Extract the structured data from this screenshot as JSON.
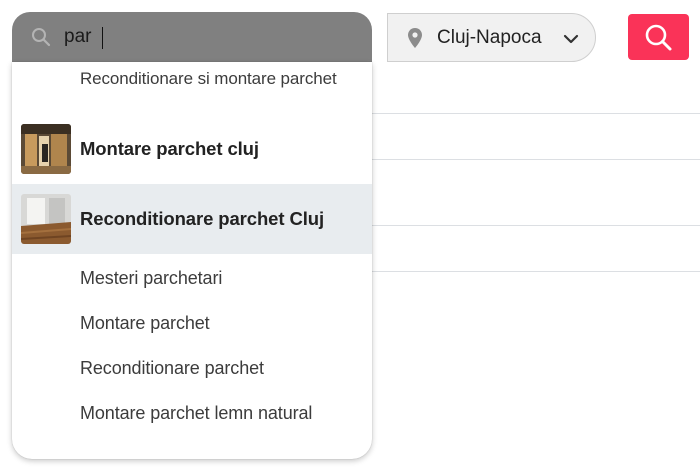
{
  "search": {
    "query": "par",
    "suggestions": [
      {
        "label": "Reconditionare si montare parchet"
      },
      {
        "label": "Montare parchet cluj"
      },
      {
        "label": "Reconditionare parchet Cluj"
      },
      {
        "label": "Mesteri parchetari"
      },
      {
        "label": "Montare parchet"
      },
      {
        "label": "Reconditionare parchet"
      },
      {
        "label": "Montare parchet lemn natural"
      }
    ],
    "highlighted_index": 2
  },
  "location": {
    "selected": "Cluj-Napoca"
  },
  "colors": {
    "search_button": "#fa3358",
    "input_background": "#808080",
    "highlight_row": "#e8ecef"
  },
  "icons": {
    "search_input": "magnifier-icon",
    "location": "map-pin-icon",
    "dropdown": "chevron-down-icon",
    "submit": "magnifier-icon"
  }
}
